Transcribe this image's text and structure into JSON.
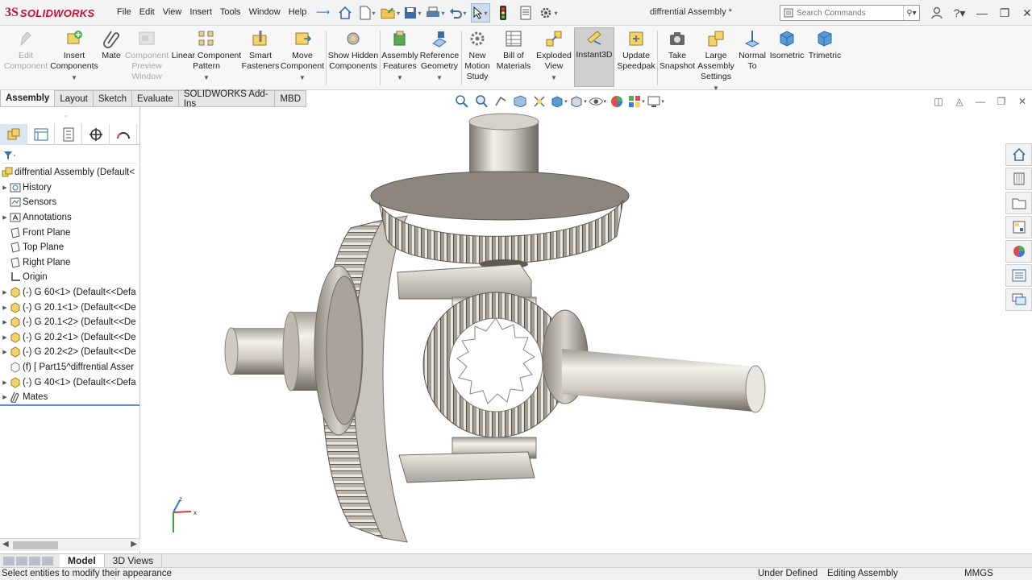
{
  "app": {
    "logo_ds": "3S",
    "logo_name": "SOLIDWORKS",
    "document_title": "diffrential Assembly *"
  },
  "menu": [
    "File",
    "Edit",
    "View",
    "Insert",
    "Tools",
    "Window",
    "Help"
  ],
  "search": {
    "placeholder": "Search Commands"
  },
  "ribbon": {
    "edit_component": "Edit Component",
    "insert_components": "Insert Components",
    "mate": "Mate",
    "component_preview": "Component Preview Window",
    "linear_pattern": "Linear Component Pattern",
    "smart_fasteners": "Smart Fasteners",
    "move_component": "Move Component",
    "show_hidden": "Show Hidden Components",
    "assembly_features": "Assembly Features",
    "reference_geometry": "Reference Geometry",
    "motion_study": "New Motion Study",
    "bill_of_materials": "Bill of Materials",
    "exploded_view": "Exploded View",
    "instant3d": "Instant3D",
    "update_speedpak": "Update Speedpak",
    "take_snapshot": "Take Snapshot",
    "large_assembly": "Large Assembly Settings",
    "normal_to": "Normal To",
    "isometric": "Isometric",
    "trimetric": "Trimetric"
  },
  "command_tabs": [
    "Assembly",
    "Layout",
    "Sketch",
    "Evaluate",
    "SOLIDWORKS Add-Ins",
    "MBD"
  ],
  "tree": {
    "root": "diffrential Assembly  (Default<",
    "items": [
      "History",
      "Sensors",
      "Annotations",
      "Front Plane",
      "Top Plane",
      "Right Plane",
      "Origin",
      "(-) G 60<1> (Default<<Defa",
      "(-) G 20.1<1> (Default<<De",
      "(-) G 20.1<2> (Default<<De",
      "(-) G 20.2<1> (Default<<De",
      "(-) G 20.2<2> (Default<<De",
      "(f) [ Part15^diffrential Asser",
      "(-) G 40<1> (Default<<Defa",
      "Mates"
    ]
  },
  "triad": {
    "x": "x",
    "z": "z"
  },
  "bottom_tabs": [
    "Model",
    "3D Views"
  ],
  "status": {
    "hint": "Select entities to modify their appearance",
    "state": "Under Defined",
    "mode": "Editing Assembly",
    "units": "MMGS"
  },
  "colors": {
    "accent": "#3b73b9",
    "brand": "#c8102e",
    "metal_light": "#e6e2dc",
    "metal_dark": "#6f6a64"
  }
}
